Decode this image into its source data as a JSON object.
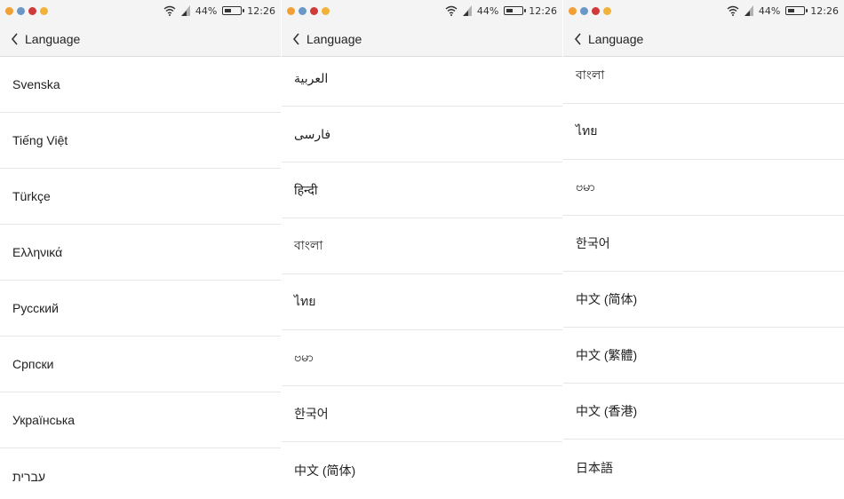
{
  "statusbar": {
    "battery_text": "44%",
    "battery_level": 0.44,
    "time": "12:26",
    "notification_icons": [
      "orange-app-icon",
      "blue-app-icon",
      "red-app-icon",
      "yellow-app-icon"
    ]
  },
  "header": {
    "title": "Language"
  },
  "colors": {
    "background": "#ffffff",
    "header_bg": "#f4f4f4",
    "divider": "#e6e6e6",
    "text": "#222222"
  },
  "panels": [
    {
      "items": [
        "Svenska",
        "Tiếng Việt",
        "Türkçe",
        "Ελληνικά",
        "Русский",
        "Српски",
        "Українська",
        "עברית"
      ]
    },
    {
      "items": [
        "العربية",
        "فارسی",
        "हिन्दी",
        "বাংলা",
        "ไทย",
        "ဗမာ",
        "한국어",
        "中文 (简体)"
      ]
    },
    {
      "items": [
        "বাংলা",
        "ไทย",
        "ဗမာ",
        "한국어",
        "中文 (简体)",
        "中文 (繁體)",
        "中文 (香港)",
        "日本語"
      ]
    }
  ]
}
